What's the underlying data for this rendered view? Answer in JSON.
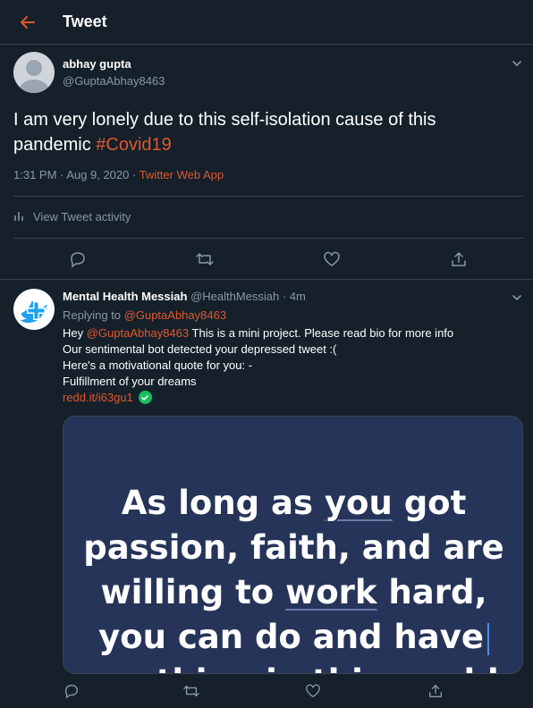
{
  "header": {
    "title": "Tweet"
  },
  "main_tweet": {
    "author_name": "abhay gupta",
    "author_handle": "@GuptaAbhay8463",
    "text_before": "I am very lonely due to this self-isolation cause of this pandemic ",
    "hashtag": "#Covid19",
    "timestamp": "1:31 PM · Aug 9, 2020 · ",
    "source": "Twitter Web App",
    "activity_label": "View Tweet activity"
  },
  "reply_tweet": {
    "author_name": "Mental Health Messiah",
    "author_handle": "@HealthMessiah · 4m",
    "replying_prefix": "Replying to ",
    "replying_handle": "@GuptaAbhay8463",
    "line1_prefix": "Hey ",
    "line1_mention": "@GuptaAbhay8463",
    "line1_rest": " This is a mini project. Please read bio for more info",
    "line2": " Our sentimental bot detected your depressed tweet :(",
    "line3": "Here's a motivational quote for you: -",
    "line4": "Fulfillment of your dreams",
    "link": "redd.it/i63gu1",
    "card": {
      "q1a": "As long as ",
      "q1u": "you",
      "q1b": " got",
      "q2": "passion, faith, and are",
      "q3a": "willing to ",
      "q3u": "work",
      "q3b": " hard,",
      "q4": "you can do and have",
      "q5": "anything in this world"
    }
  },
  "colors": {
    "background": "#15202b",
    "accent": "#e0582d",
    "muted": "#8899a6",
    "card": "#263459",
    "verified": "#17bf63"
  },
  "icons": [
    "back-arrow-icon",
    "chevron-down-icon",
    "bar-chart-icon",
    "reply-icon",
    "retweet-icon",
    "like-icon",
    "share-icon",
    "check-icon"
  ]
}
